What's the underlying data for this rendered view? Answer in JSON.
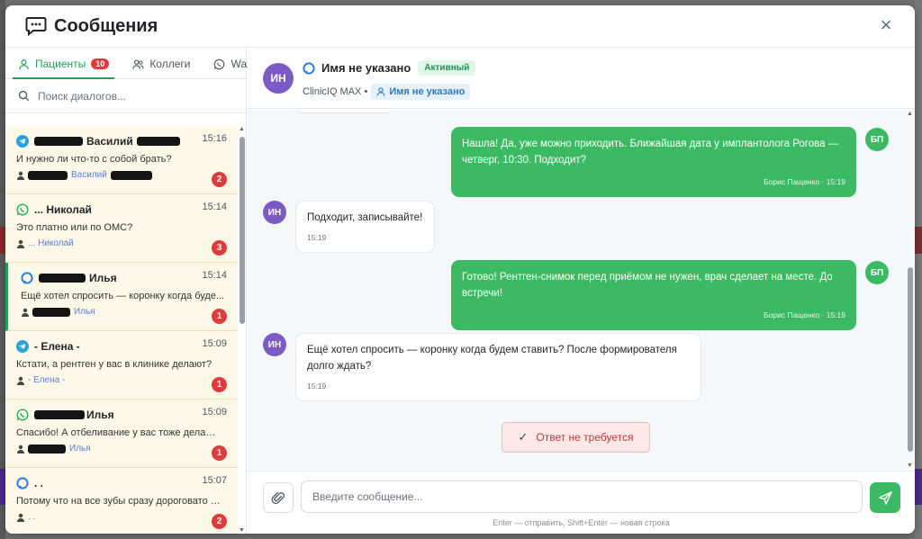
{
  "colors": {
    "accent": "#22a05a",
    "outgoing": "#3cba63",
    "badge": "#e03b3b",
    "avatar_in": "#7c5cc4",
    "dialog_bg": "#fdf8e8"
  },
  "modal": {
    "title": "Сообщения",
    "title_icon": "chat-bubble-icon",
    "close_label": "×"
  },
  "tabs": [
    {
      "label": "Пациенты",
      "badge": "10",
      "icon": "person-icon",
      "active": true
    },
    {
      "label": "Коллеги",
      "icon": "people-icon"
    },
    {
      "label": "Wazzup",
      "icon": "whatsapp-icon"
    }
  ],
  "search": {
    "placeholder": "Поиск диалогов..."
  },
  "dialogs": [
    {
      "channel": "telegram-icon",
      "name": "Василий",
      "time": "15:16",
      "message": "И нужно ли что-то с собой брать?",
      "contact": "Василий",
      "unread": "2"
    },
    {
      "channel": "whatsapp-icon",
      "name": "... Николай",
      "time": "15:14",
      "message": "Это платно или по ОМС?",
      "contact": "... Николай",
      "unread": "3"
    },
    {
      "channel": "max-icon",
      "name": "Илья",
      "time": "15:14",
      "message": "Ещё хотел спросить — коронку когда буде...",
      "contact": "Илья",
      "unread": "1"
    },
    {
      "channel": "telegram-icon",
      "name": "- Елена -",
      "time": "15:09",
      "message": "Кстати, а рентген у вас в клинике делают?",
      "contact": "- Елена -",
      "unread": "1"
    },
    {
      "channel": "whatsapp-icon",
      "name": "Илья",
      "time": "15:09",
      "message": "Спасибо! А отбеливание у вас тоже делают?",
      "contact": "Илья",
      "unread": "1"
    },
    {
      "channel": "max-icon",
      "name": ". .",
      "time": "15:07",
      "message": "Потому что на все зубы сразу дороговато в...",
      "contact": ". .",
      "unread": "2"
    }
  ],
  "chat": {
    "avatar": "ИН",
    "name": "Имя не указано",
    "status": "Активный",
    "source": "ClinicIQ MAX •",
    "assigned": "Имя не указано",
    "messages": [
      {
        "dir": "out",
        "avatar": "БП",
        "text": "Нашла! Да, уже можно приходить. Ближайшая дата у имплантолога Рогова — четверг, 10:30. Подходит?",
        "meta": "Борис Пащенко · 15:19"
      },
      {
        "dir": "in",
        "avatar": "ИН",
        "text": "Подходит, записывайте!",
        "meta": "15:19"
      },
      {
        "dir": "out",
        "avatar": "БП",
        "text": "Готово! Рентген-снимок перед приёмом не нужен, врач сделает на месте. До встречи!",
        "meta": "Борис Пащенко · 15:19"
      },
      {
        "dir": "in",
        "avatar": "ИН",
        "text": "Ещё хотел спросить — коронку когда будем ставить? После формирователя долго ждать?",
        "meta": "15:19"
      }
    ],
    "no_reply_button": "Ответ не требуется"
  },
  "composer": {
    "placeholder": "Введите сообщение...",
    "hint": "Enter — отправить, Shift+Enter — новая строка"
  }
}
